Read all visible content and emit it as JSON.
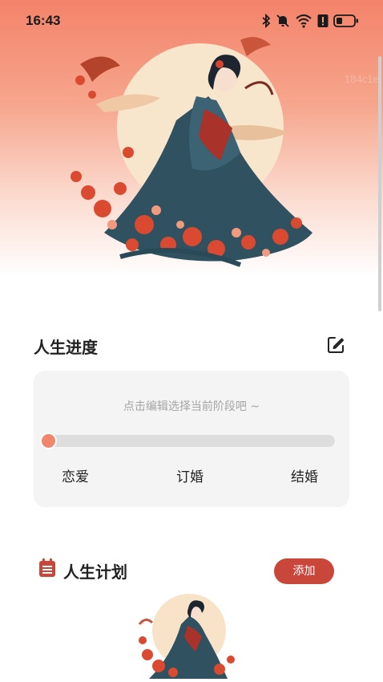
{
  "status_bar": {
    "time": "16:43",
    "icons": [
      "bluetooth-icon",
      "mute-bell-icon",
      "wifi-icon",
      "alert-icon",
      "battery-icon"
    ]
  },
  "hero": {
    "watermark": "184c1e",
    "illustration": "woman-in-hanfu-illustration"
  },
  "life_progress": {
    "title": "人生进度",
    "hint": "点击编辑选择当前阶段吧 ~",
    "stages": [
      "恋爱",
      "订婚",
      "结婚"
    ],
    "progress_fraction": 0
  },
  "life_plan": {
    "title": "人生计划",
    "add_label": "添加",
    "empty_illustration": "woman-in-hanfu-illustration-small"
  },
  "colors": {
    "accent": "#f0866c",
    "button": "#c9463b",
    "card_bg": "#f4f4f4",
    "header_gradient_top": "#f3836a"
  }
}
